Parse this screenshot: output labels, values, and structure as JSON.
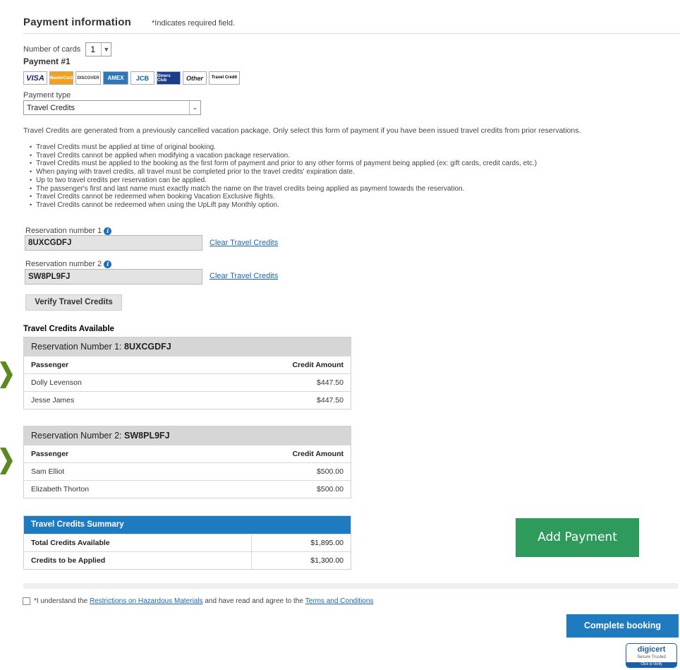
{
  "header": {
    "title": "Payment information",
    "required_note": "*Indicates required field."
  },
  "num_cards": {
    "label": "Number of cards",
    "value": "1"
  },
  "payment_label": "Payment #1",
  "card_logos": [
    {
      "name": "visa-logo",
      "text": "VISA"
    },
    {
      "name": "mastercard-logo",
      "text": "MasterCard"
    },
    {
      "name": "discover-logo",
      "text": "DISCOVER"
    },
    {
      "name": "amex-logo",
      "text": "AMEX"
    },
    {
      "name": "jcb-logo",
      "text": "JCB"
    },
    {
      "name": "diners-club-logo",
      "text": "Diners Club"
    },
    {
      "name": "other-card-logo",
      "text": "Other"
    },
    {
      "name": "travel-credit-logo",
      "text": "Travel Credit"
    }
  ],
  "payment_type": {
    "label": "Payment type",
    "value": "Travel Credits"
  },
  "intro": "Travel Credits are generated from a previously cancelled vacation package. Only select this form of payment if you have been issued travel credits from prior reservations.",
  "rules": [
    "Travel Credits must be applied at time of original booking.",
    "Travel Credits cannot be applied when modifying a vacation package reservation.",
    "Travel Credits must be applied to the booking as the first form of payment and prior to any other forms of payment being applied (ex: gift cards, credit cards, etc.)",
    "When paying with travel credits, all travel must be completed prior to the travel credits' expiration date.",
    "Up to two travel credits per reservation can be applied.",
    "The passenger's first and last name must exactly match the name on the travel credits being applied as payment towards the reservation.",
    "Travel Credits cannot be redeemed when booking Vacation Exclusive flights.",
    "Travel Credits cannot be redeemed when using the UpLift pay Monthly option."
  ],
  "reservations": [
    {
      "label": "Reservation number 1",
      "value": "8UXCGDFJ",
      "clear": "Clear Travel Credits"
    },
    {
      "label": "Reservation number 2",
      "value": "SW8PL9FJ",
      "clear": "Clear Travel Credits"
    }
  ],
  "verify_button": "Verify Travel Credits",
  "credits_heading": "Travel Credits Available",
  "credit_tables": [
    {
      "title_prefix": "Reservation Number 1: ",
      "title_code": "8UXCGDFJ",
      "col_passenger": "Passenger",
      "col_amount": "Credit Amount",
      "rows": [
        {
          "passenger": "Dolly Levenson",
          "amount": "$447.50"
        },
        {
          "passenger": "Jesse James",
          "amount": "$447.50"
        }
      ]
    },
    {
      "title_prefix": "Reservation Number 2: ",
      "title_code": "SW8PL9FJ",
      "col_passenger": "Passenger",
      "col_amount": "Credit Amount",
      "rows": [
        {
          "passenger": "Sam Elliot",
          "amount": "$500.00"
        },
        {
          "passenger": "Elizabeth Thorton",
          "amount": "$500.00"
        }
      ]
    }
  ],
  "summary": {
    "title": "Travel Credits Summary",
    "rows": [
      {
        "label": "Total Credits Available",
        "value": "$1,895.00"
      },
      {
        "label": "Credits to be Applied",
        "value": "$1,300.00"
      }
    ]
  },
  "add_payment": "Add Payment",
  "agree": {
    "prefix": "*I understand the ",
    "link1": "Restrictions on Hazardous Materials",
    "middle": " and have read and agree to the ",
    "link2": "Terms and Conditions"
  },
  "complete_button": "Complete booking",
  "digicert": {
    "name": "digicert",
    "sub": "Secure Trusted",
    "bar": "Click to Verify"
  },
  "colors": {
    "primary_blue": "#1f7bc0",
    "link_blue": "#1b66b3",
    "add_payment_green": "#2e9a5c",
    "marker_green": "#5a8a1f",
    "table_header_gray": "#d6d6d6"
  }
}
